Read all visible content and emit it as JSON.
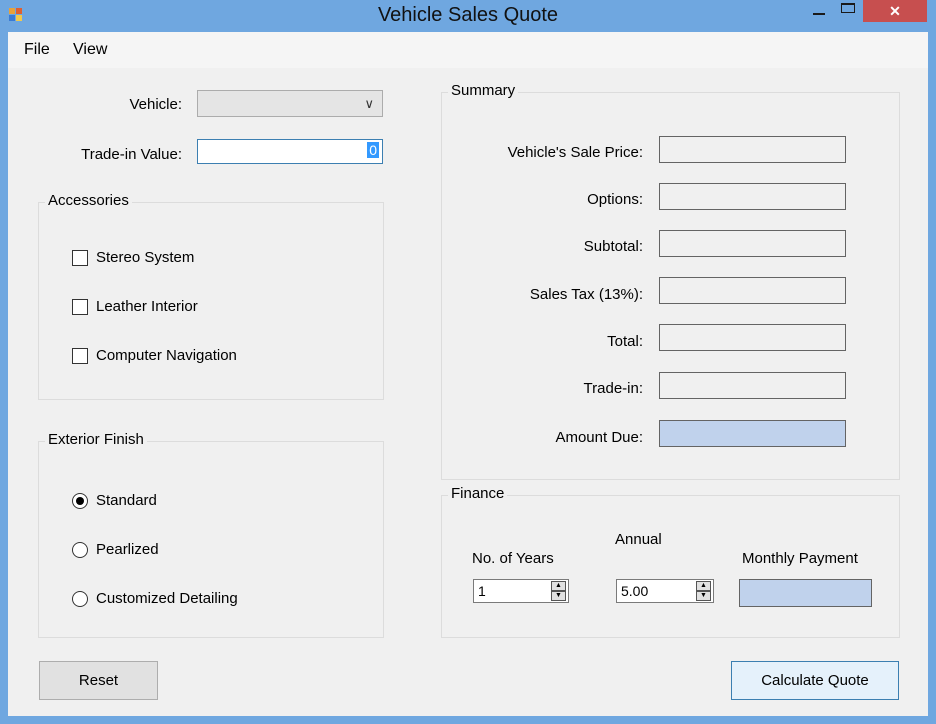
{
  "window": {
    "title": "Vehicle Sales Quote",
    "close_glyph": "✕"
  },
  "menu": {
    "file": "File",
    "view": "View"
  },
  "form": {
    "vehicle_label": "Vehicle:",
    "vehicle_value": "",
    "tradein_label": "Trade-in Value:",
    "tradein_value": "0"
  },
  "accessories": {
    "title": "Accessories",
    "items": [
      {
        "label": "Stereo System",
        "checked": false
      },
      {
        "label": "Leather Interior",
        "checked": false
      },
      {
        "label": "Computer Navigation",
        "checked": false
      }
    ]
  },
  "exterior": {
    "title": "Exterior Finish",
    "items": [
      {
        "label": "Standard",
        "selected": true
      },
      {
        "label": "Pearlized",
        "selected": false
      },
      {
        "label": "Customized Detailing",
        "selected": false
      }
    ]
  },
  "summary": {
    "title": "Summary",
    "rows": [
      {
        "label": "Vehicle's Sale Price:",
        "value": ""
      },
      {
        "label": "Options:",
        "value": ""
      },
      {
        "label": "Subtotal:",
        "value": ""
      },
      {
        "label": "Sales Tax (13%):",
        "value": ""
      },
      {
        "label": "Total:",
        "value": ""
      },
      {
        "label": "Trade-in:",
        "value": ""
      },
      {
        "label": "Amount Due:",
        "value": ""
      }
    ]
  },
  "finance": {
    "title": "Finance",
    "years_label": "No. of Years",
    "years_value": "1",
    "annual_label": "Annual",
    "annual_value": "5.00",
    "monthly_label": "Monthly Payment",
    "monthly_value": ""
  },
  "buttons": {
    "reset": "Reset",
    "calculate": "Calculate Quote"
  },
  "colors": {
    "titlebar": "#6FA7E0",
    "close_button": "#C74F4F",
    "highlight_output": "#C0D2EC",
    "background": "#F0F0F0"
  }
}
